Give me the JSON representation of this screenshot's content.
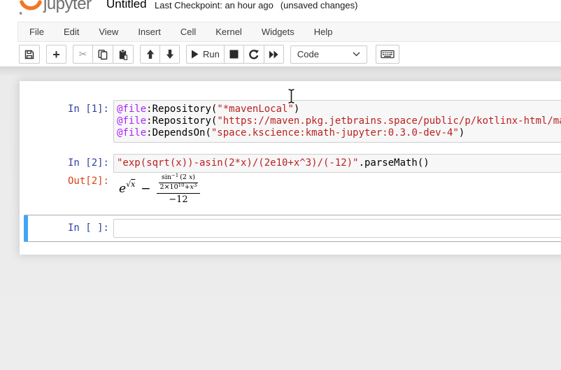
{
  "header": {
    "logo_text": "jupyter",
    "title": "Untitled",
    "checkpoint": "Last Checkpoint: an hour ago",
    "modified": "(unsaved changes)"
  },
  "menu": {
    "items": [
      "File",
      "Edit",
      "View",
      "Insert",
      "Cell",
      "Kernel",
      "Widgets",
      "Help"
    ]
  },
  "toolbar": {
    "run_label": "Run",
    "cell_type_value": "Code"
  },
  "colors": {
    "accent_orange": "#F37726",
    "prompt_in": "#303F9F",
    "prompt_out": "#D84315",
    "selected_cell_bar": "#42A5F5",
    "code_meta": "#AA22FF",
    "code_string": "#BA2121"
  },
  "notebook": {
    "cells": [
      {
        "type": "code",
        "prompt": "In [1]:",
        "source_tokens": [
          [
            {
              "c": "meta",
              "t": "@file"
            },
            {
              "c": "plain",
              "t": ":Repository("
            },
            {
              "c": "string",
              "t": "\"*mavenLocal\""
            },
            {
              "c": "plain",
              "t": ")"
            }
          ],
          [
            {
              "c": "meta",
              "t": "@file"
            },
            {
              "c": "plain",
              "t": ":Repository("
            },
            {
              "c": "string",
              "t": "\"https://maven.pkg.jetbrains.space/public/p/kotlinx-html/maven\""
            },
            {
              "c": "plain",
              "t": ")"
            }
          ],
          [
            {
              "c": "meta",
              "t": "@file"
            },
            {
              "c": "plain",
              "t": ":DependsOn("
            },
            {
              "c": "string",
              "t": "\"space.kscience:kmath-jupyter:0.3.0-dev-4\""
            },
            {
              "c": "plain",
              "t": ")"
            }
          ]
        ]
      },
      {
        "type": "code",
        "prompt": "In [2]:",
        "source_tokens": [
          [
            {
              "c": "string",
              "t": "\"exp(sqrt(x))-asin(2*x)/(2e10+x^3)/(-12)\""
            },
            {
              "c": "plain",
              "t": ".parseMath()"
            }
          ]
        ],
        "output": {
          "prompt": "Out[2]:",
          "math": {
            "base": "e",
            "sqrt": "√",
            "sqrt_arg": "x",
            "minus": "−",
            "sin": "sin",
            "sin_sup": "−1",
            "arg_open": "(2 ",
            "arg_x": "x",
            "arg_close": ")",
            "den1_lead": "2×10",
            "den1_sup": "10",
            "den1_plus": "+",
            "den1_x": "x",
            "den1_xsup": "3",
            "den2": "−12"
          }
        }
      },
      {
        "type": "code",
        "prompt": "In [ ]:",
        "selected": true,
        "source_tokens": [
          []
        ]
      }
    ]
  }
}
